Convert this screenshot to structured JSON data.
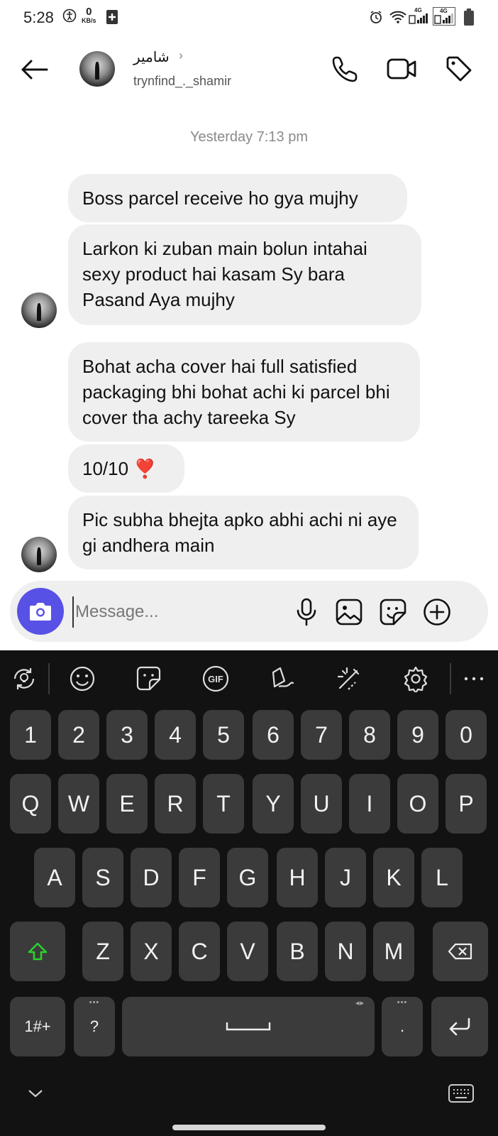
{
  "status_bar": {
    "time": "5:28",
    "speed_value": "0",
    "speed_unit": "KB/s",
    "network_1": "4G",
    "network_2": "4G"
  },
  "header": {
    "display_name": "شامیر",
    "chevron": "›",
    "username": "trynfind_._shamir"
  },
  "chat": {
    "timestamp": "Yesterday 7:13 pm",
    "messages": [
      {
        "text": "Boss parcel receive ho gya mujhy"
      },
      {
        "text": "Larkon ki zuban main bolun intahai sexy product hai kasam Sy bara Pasand Aya mujhy"
      },
      {
        "text": "Bohat acha cover hai full satisfied packaging bhi bohat achi ki parcel bhi cover tha achy tareeka Sy"
      },
      {
        "text": "10/10",
        "emoji": "❣️"
      },
      {
        "text": "Pic subha bhejta apko abhi achi ni aye gi andhera main"
      }
    ]
  },
  "composer": {
    "placeholder": "Message..."
  },
  "keyboard": {
    "toolbar": [
      "translate-icon",
      "emoji-icon",
      "sticker-icon",
      "gif-icon",
      "handwriting-icon",
      "text-edit-icon",
      "settings-icon",
      "more-icon"
    ],
    "gif_label": "GIF",
    "more_label": "⋮",
    "number_row": [
      "1",
      "2",
      "3",
      "4",
      "5",
      "6",
      "7",
      "8",
      "9",
      "0"
    ],
    "row1": [
      "Q",
      "W",
      "E",
      "R",
      "T",
      "Y",
      "U",
      "I",
      "O",
      "P"
    ],
    "row2": [
      "A",
      "S",
      "D",
      "F",
      "G",
      "H",
      "J",
      "K",
      "L"
    ],
    "row3": [
      "Z",
      "X",
      "C",
      "V",
      "B",
      "N",
      "M"
    ],
    "symbols_label": "1#+",
    "question_label": "?",
    "period_label": ".",
    "dots_label": "•••",
    "arrows_label": "◂▸"
  },
  "colors": {
    "accent": "#5851e6",
    "bubble": "#efefef",
    "keyboard_bg": "#121212",
    "key_bg": "#3b3b3b",
    "shift_green": "#2bd12b"
  }
}
